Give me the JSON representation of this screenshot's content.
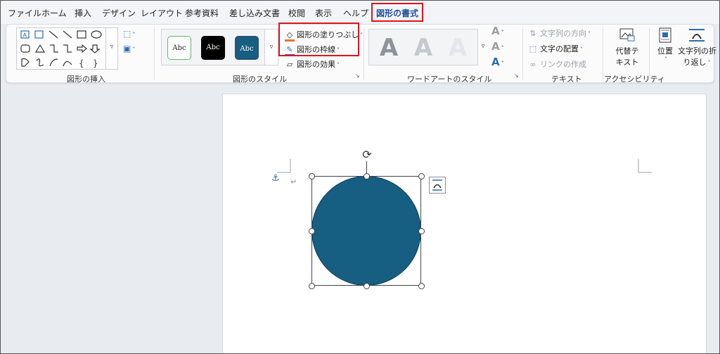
{
  "menu_tabs": [
    "ファイル",
    "ホーム",
    "挿入",
    "デザイン",
    "レイアウト",
    "参考資料",
    "差し込み文書",
    "校閲",
    "表示",
    "ヘルプ",
    "図形の書式"
  ],
  "ribbon": {
    "groups": {
      "insert_shapes": "図形の挿入",
      "shape_styles": "図形のスタイル",
      "wordart_styles": "ワードアートのスタイル",
      "text": "テキスト",
      "accessibility": "アクセシビリティ"
    },
    "style_samples": [
      "Abc",
      "Abc",
      "Abc"
    ],
    "shape_fill": "図形の塗りつぶし",
    "shape_outline": "図形の枠線",
    "shape_effects": "図形の効果",
    "wordart_letters": [
      "A",
      "A",
      "A"
    ],
    "text_direction": "文字列の方向",
    "text_align": "文字の配置",
    "create_link": "リンクの作成",
    "alt_text": [
      "代替テ",
      "キスト"
    ],
    "position": "位置",
    "wrap_text": [
      "文字列の折",
      "り返し"
    ]
  },
  "colors": {
    "accent": "#1e4f9c",
    "highlight": "#e0141e",
    "shape_fill": "#165e82"
  }
}
